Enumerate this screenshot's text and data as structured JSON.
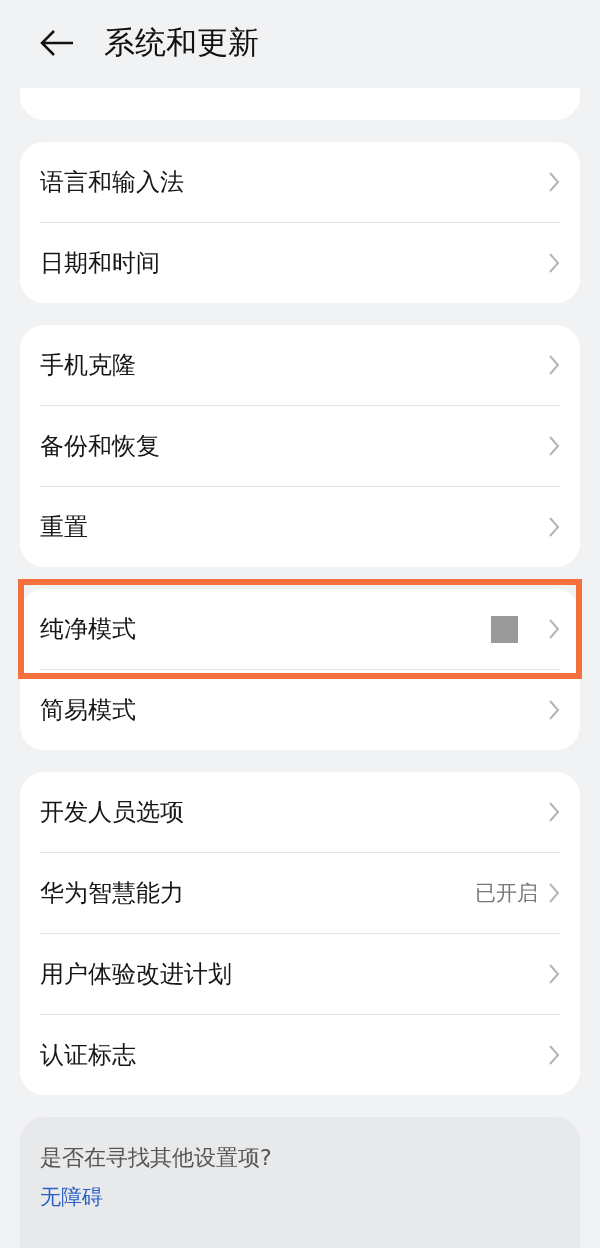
{
  "header": {
    "title": "系统和更新"
  },
  "groups": [
    {
      "items": [
        {
          "label": "语言和输入法"
        },
        {
          "label": "日期和时间"
        }
      ]
    },
    {
      "items": [
        {
          "label": "手机克隆"
        },
        {
          "label": "备份和恢复"
        },
        {
          "label": "重置"
        }
      ]
    },
    {
      "items": [
        {
          "label": "纯净模式",
          "highlighted": true,
          "redacted": true
        },
        {
          "label": "简易模式",
          "highlighted": false
        }
      ]
    },
    {
      "items": [
        {
          "label": "开发人员选项"
        },
        {
          "label": "华为智慧能力",
          "value": "已开启"
        },
        {
          "label": "用户体验改进计划"
        },
        {
          "label": "认证标志"
        }
      ]
    }
  ],
  "suggestion": {
    "question": "是否在寻找其他设置项?",
    "link": "无障碍"
  }
}
